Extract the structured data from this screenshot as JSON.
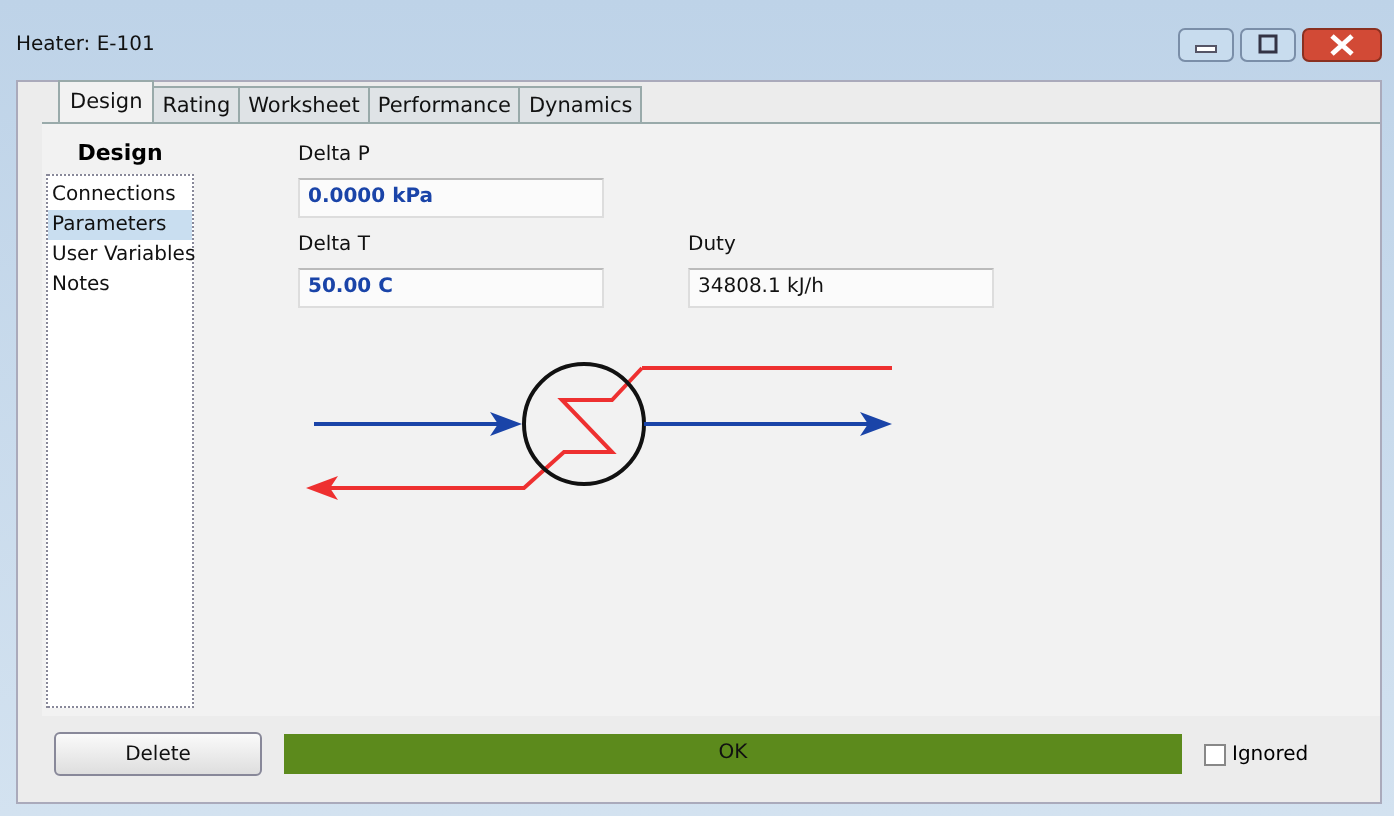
{
  "window": {
    "title": "Heater: E-101"
  },
  "tabs": [
    {
      "label": "Design",
      "selected": true
    },
    {
      "label": "Rating",
      "selected": false
    },
    {
      "label": "Worksheet",
      "selected": false
    },
    {
      "label": "Performance",
      "selected": false
    },
    {
      "label": "Dynamics",
      "selected": false
    }
  ],
  "sidebar": {
    "title": "Design",
    "items": [
      {
        "label": "Connections",
        "selected": false
      },
      {
        "label": "Parameters",
        "selected": true
      },
      {
        "label": "User Variables",
        "selected": false
      },
      {
        "label": "Notes",
        "selected": false
      }
    ]
  },
  "field_rows": [
    [
      {
        "label": "Delta P",
        "value": "0.0000 kPa",
        "kind": "specified"
      }
    ],
    [
      {
        "label": "Delta T",
        "value": "50.00 C",
        "kind": "specified"
      },
      {
        "label": "Duty",
        "value": "34808.1 kJ/h",
        "kind": "calculated"
      }
    ]
  ],
  "delete_button": "Delete",
  "status": {
    "text": "OK"
  },
  "ignored": {
    "label": "Ignored",
    "checked": false
  }
}
